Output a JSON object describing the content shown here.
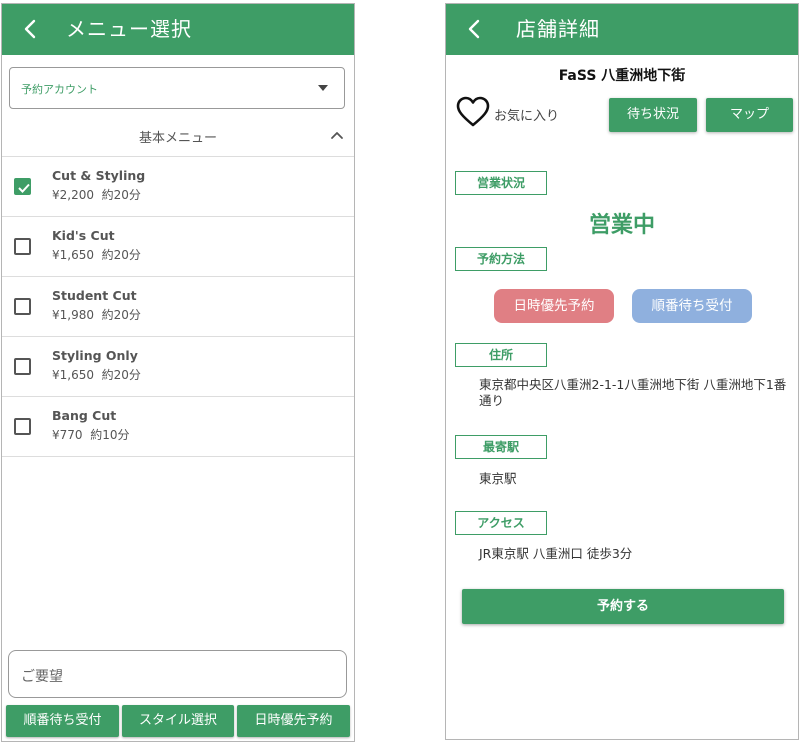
{
  "left_screen": {
    "header": {
      "title": "メニュー選択"
    },
    "account_select": {
      "label": "予約アカウント"
    },
    "section": {
      "title": "基本メニュー"
    },
    "menu_items": [
      {
        "name": "Cut & Styling",
        "price": "¥2,200",
        "duration": "約20分",
        "checked": true
      },
      {
        "name": "Kid's Cut",
        "price": "¥1,650",
        "duration": "約20分",
        "checked": false
      },
      {
        "name": "Student Cut",
        "price": "¥1,980",
        "duration": "約20分",
        "checked": false
      },
      {
        "name": "Styling Only",
        "price": "¥1,650",
        "duration": "約20分",
        "checked": false
      },
      {
        "name": "Bang Cut",
        "price": "¥770",
        "duration": "約10分",
        "checked": false
      }
    ],
    "request_field": {
      "placeholder": "ご要望"
    },
    "bottom_buttons": [
      {
        "label": "順番待ち受付"
      },
      {
        "label": "スタイル選択"
      },
      {
        "label": "日時優先予約"
      }
    ]
  },
  "right_screen": {
    "header": {
      "title": "店舗詳細"
    },
    "shop_name": "FaSS 八重洲地下街",
    "favorite_label": "お気に入り",
    "wait_status_button": "待ち状況",
    "map_button": "マップ",
    "sections": {
      "business_status": {
        "label": "営業状況",
        "value": "営業中"
      },
      "reservation_method": {
        "label": "予約方法",
        "date_priority": "日時優先予約",
        "queue": "順番待ち受付"
      },
      "address": {
        "label": "住所",
        "value": "東京都中央区八重洲2-1-1八重洲地下街 八重洲地下1番通り"
      },
      "nearest_station": {
        "label": "最寄駅",
        "value": "東京駅"
      },
      "access": {
        "label": "アクセス",
        "value": "JR東京駅 八重洲口 徒歩3分"
      }
    },
    "reserve_button": "予約する"
  },
  "colors": {
    "brand_green": "#3e9d66",
    "date_priority_pill": "#e07f84",
    "queue_pill": "#8fb0de"
  }
}
